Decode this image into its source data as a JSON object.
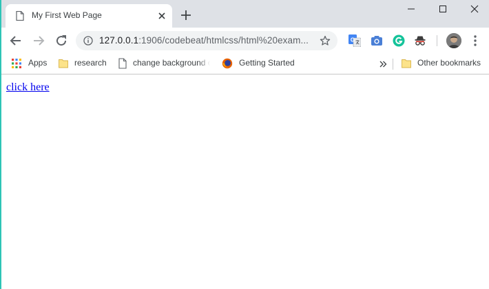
{
  "tab": {
    "title": "My First Web Page",
    "favicon": "page-icon"
  },
  "window_controls": [
    "minimize-icon",
    "maximize-icon",
    "close-icon"
  ],
  "toolbar": {
    "url_host": "127.0.0.1",
    "url_rest": ":1906/codebeat/htmlcss/html%20exam...",
    "extensions": [
      "translate-icon",
      "camera-icon",
      "grammarly-icon",
      "incognito-icon"
    ]
  },
  "bookmarks": {
    "items": [
      {
        "label": "Apps",
        "icon": "apps-grid-icon"
      },
      {
        "label": "research",
        "icon": "folder-icon"
      },
      {
        "label": "change background c",
        "icon": "page-icon"
      },
      {
        "label": "Getting Started",
        "icon": "firefox-icon"
      }
    ],
    "other": {
      "label": "Other bookmarks",
      "icon": "folder-icon"
    }
  },
  "page": {
    "link_text": "click here"
  },
  "colors": {
    "tabstrip": "#dee1e6",
    "omnibox": "#f1f3f4",
    "link": "#0000ee",
    "left_edge": "#2ec4b6"
  }
}
